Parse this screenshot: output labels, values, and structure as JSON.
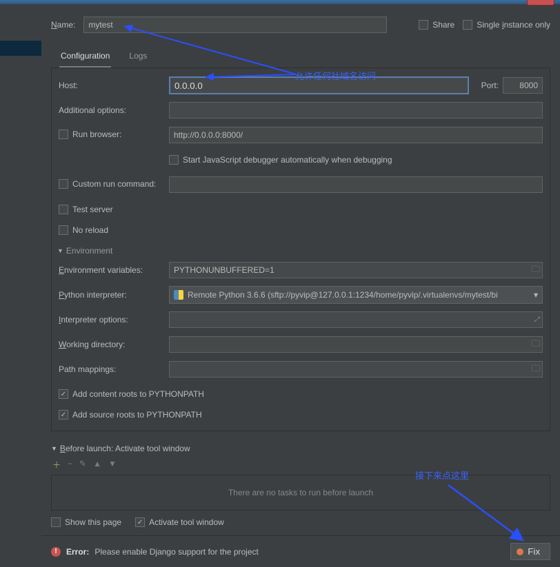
{
  "topbar": {
    "name_label": "Name:",
    "name_value": "mytest",
    "share_label": "Share",
    "single_instance_label": "Single instance only"
  },
  "tabs": {
    "configuration": "Configuration",
    "logs": "Logs"
  },
  "form": {
    "host_label": "Host:",
    "host_value": "0.0.0.0",
    "port_label": "Port:",
    "port_value": "8000",
    "additional_options_label": "Additional options:",
    "additional_options_value": "",
    "run_browser_label": "Run browser:",
    "run_browser_url": "http://0.0.0.0:8000/",
    "start_js_debugger_label": "Start JavaScript debugger automatically when debugging",
    "custom_run_command_label": "Custom run command:",
    "custom_run_command_value": "",
    "test_server_label": "Test server",
    "no_reload_label": "No reload"
  },
  "environment": {
    "header": "Environment",
    "env_vars_label": "Environment variables:",
    "env_vars_value": "PYTHONUNBUFFERED=1",
    "python_interpreter_label": "Python interpreter:",
    "python_interpreter_value": "Remote Python 3.6.6 (sftp://pyvip@127.0.0.1:1234/home/pyvip/.virtualenvs/mytest/bi",
    "interpreter_options_label": "Interpreter options:",
    "interpreter_options_value": "",
    "working_directory_label": "Working directory:",
    "working_directory_value": "",
    "path_mappings_label": "Path mappings:",
    "path_mappings_value": "",
    "add_content_roots_label": "Add content roots to PYTHONPATH",
    "add_source_roots_label": "Add source roots to PYTHONPATH"
  },
  "before_launch": {
    "header": "Before launch: Activate tool window",
    "empty_text": "There are no tasks to run before launch",
    "show_this_page_label": "Show this page",
    "activate_tool_window_label": "Activate tool window"
  },
  "error": {
    "label": "Error:",
    "message": "Please enable Django support for the project",
    "fix_label": "Fix"
  },
  "annotations": {
    "allow_any_host": "允许任何社域名访问",
    "click_here_next": "接下来点这里"
  }
}
